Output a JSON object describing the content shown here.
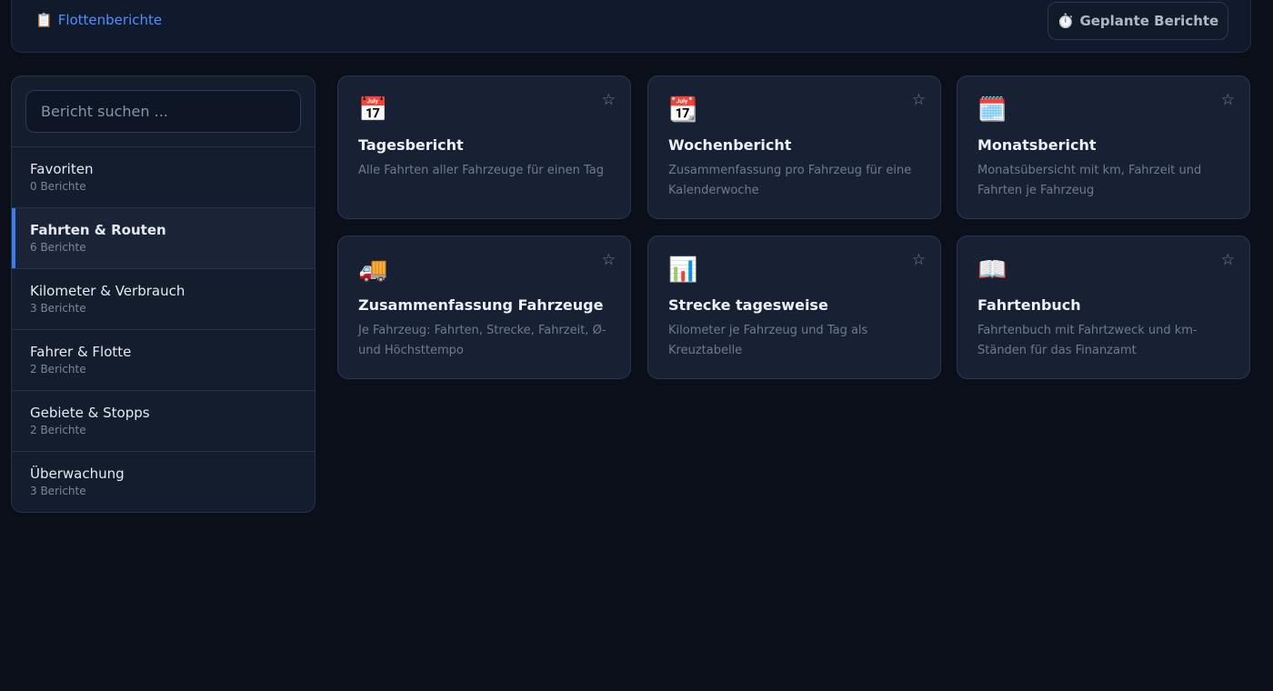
{
  "header": {
    "breadcrumb_icon": "📋",
    "breadcrumb_label": "Flottenberichte",
    "scheduled_icon": "⏱️",
    "scheduled_label": "Geplante Berichte"
  },
  "sidebar": {
    "search_placeholder": "Bericht suchen ...",
    "items": [
      {
        "label": "Favoriten",
        "count": "0 Berichte"
      },
      {
        "label": "Fahrten & Routen",
        "count": "6 Berichte"
      },
      {
        "label": "Kilometer & Verbrauch",
        "count": "3 Berichte"
      },
      {
        "label": "Fahrer & Flotte",
        "count": "2 Berichte"
      },
      {
        "label": "Gebiete & Stopps",
        "count": "2 Berichte"
      },
      {
        "label": "Überwachung",
        "count": "3 Berichte"
      }
    ]
  },
  "cards": [
    {
      "icon": "📅",
      "title": "Tagesbericht",
      "desc": "Alle Fahrten aller Fahrzeuge für einen Tag",
      "star": "☆"
    },
    {
      "icon": "📆",
      "title": "Wochenbericht",
      "desc": "Zusammenfassung pro Fahrzeug für eine Kalenderwoche",
      "star": "☆"
    },
    {
      "icon": "🗓️",
      "title": "Monatsbericht",
      "desc": "Monatsübersicht mit km, Fahrzeit und Fahrten je Fahrzeug",
      "star": "☆"
    },
    {
      "icon": "🚚",
      "title": "Zusammenfassung Fahrzeuge",
      "desc": "Je Fahrzeug: Fahrten, Strecke, Fahrzeit, Ø- und Höchsttempo",
      "star": "☆"
    },
    {
      "icon": "📊",
      "title": "Strecke tagesweise",
      "desc": "Kilometer je Fahrzeug und Tag als Kreuztabelle",
      "star": "☆"
    },
    {
      "icon": "📖",
      "title": "Fahrtenbuch",
      "desc": "Fahrtenbuch mit Fahrtzweck und km-Ständen für das Finanzamt",
      "star": "☆"
    }
  ]
}
